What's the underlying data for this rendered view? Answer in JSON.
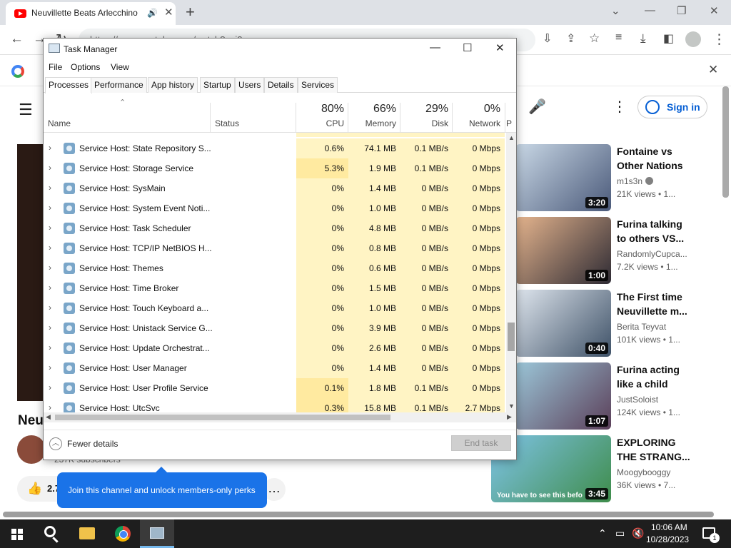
{
  "browser": {
    "tab_title": "Neuvillette Beats Arlecchino",
    "tab_icon": "youtube-icon",
    "tab_audio_icon": "speaker-icon",
    "url_partial": "https://www.youtube.com/watch?v=j2...",
    "bookmark_icon": "google-icon"
  },
  "youtube": {
    "signin_label": "Sign in",
    "video_title_partial": "Neu",
    "subscriber_text_partial": "237K subscribers",
    "like_count_partial": "2.7",
    "tooltip_text": "Join this channel and unlock members-only perks",
    "recommendations": [
      {
        "title": "Fontaine vs Other Nations",
        "channel": "m1s3n",
        "verified": true,
        "views": "21K views • 1...",
        "duration": "3:20",
        "color_a": "#c9d8e6",
        "color_b": "#4b5a7a"
      },
      {
        "title": "Furina talking to others VS...",
        "channel": "RandomlyCupca...",
        "verified": false,
        "views": "7.2K views • 1...",
        "duration": "1:00",
        "color_a": "#e6b58e",
        "color_b": "#2d2a33"
      },
      {
        "title": "The First time Neuvillette m...",
        "channel": "Berita Teyvat",
        "verified": false,
        "views": "101K views • 1...",
        "duration": "0:40",
        "color_a": "#dfe6ee",
        "color_b": "#3e5167"
      },
      {
        "title": "Furina acting like a child",
        "channel": "JustSoloist",
        "verified": false,
        "views": "124K views • 1...",
        "duration": "1:07",
        "color_a": "#9cc7d9",
        "color_b": "#5b3f59"
      },
      {
        "title": "EXPLORING THE STRANG...",
        "channel": "Moogybooggy",
        "verified": false,
        "views": "36K views • 7...",
        "duration": "3:45",
        "caption": "You have to see this befo",
        "color_a": "#7fc4e8",
        "color_b": "#3e8c4a"
      }
    ]
  },
  "task_manager": {
    "title": "Task Manager",
    "menu": [
      "File",
      "Options",
      "View"
    ],
    "tabs": [
      "Processes",
      "Performance",
      "App history",
      "Startup",
      "Users",
      "Details",
      "Services"
    ],
    "active_tab": "Processes",
    "columns": {
      "name": "Name",
      "status": "Status",
      "cpu": {
        "pct": "80%",
        "label": "CPU"
      },
      "memory": {
        "pct": "66%",
        "label": "Memory"
      },
      "disk": {
        "pct": "29%",
        "label": "Disk"
      },
      "network": {
        "pct": "0%",
        "label": "Network"
      },
      "power_partial": "P"
    },
    "rows": [
      {
        "name": "Service Host: State Repository S...",
        "cpu": "0.6%",
        "memory": "74.1 MB",
        "disk": "0.1 MB/s",
        "network": "0 Mbps"
      },
      {
        "name": "Service Host: Storage Service",
        "cpu": "5.3%",
        "memory": "1.9 MB",
        "disk": "0.1 MB/s",
        "network": "0 Mbps"
      },
      {
        "name": "Service Host: SysMain",
        "cpu": "0%",
        "memory": "1.4 MB",
        "disk": "0 MB/s",
        "network": "0 Mbps"
      },
      {
        "name": "Service Host: System Event Noti...",
        "cpu": "0%",
        "memory": "1.0 MB",
        "disk": "0 MB/s",
        "network": "0 Mbps"
      },
      {
        "name": "Service Host: Task Scheduler",
        "cpu": "0%",
        "memory": "4.8 MB",
        "disk": "0 MB/s",
        "network": "0 Mbps"
      },
      {
        "name": "Service Host: TCP/IP NetBIOS H...",
        "cpu": "0%",
        "memory": "0.8 MB",
        "disk": "0 MB/s",
        "network": "0 Mbps"
      },
      {
        "name": "Service Host: Themes",
        "cpu": "0%",
        "memory": "0.6 MB",
        "disk": "0 MB/s",
        "network": "0 Mbps"
      },
      {
        "name": "Service Host: Time Broker",
        "cpu": "0%",
        "memory": "1.5 MB",
        "disk": "0 MB/s",
        "network": "0 Mbps"
      },
      {
        "name": "Service Host: Touch Keyboard a...",
        "cpu": "0%",
        "memory": "1.0 MB",
        "disk": "0 MB/s",
        "network": "0 Mbps"
      },
      {
        "name": "Service Host: Unistack Service G...",
        "cpu": "0%",
        "memory": "3.9 MB",
        "disk": "0 MB/s",
        "network": "0 Mbps"
      },
      {
        "name": "Service Host: Update Orchestrat...",
        "cpu": "0%",
        "memory": "2.6 MB",
        "disk": "0 MB/s",
        "network": "0 Mbps"
      },
      {
        "name": "Service Host: User Manager",
        "cpu": "0%",
        "memory": "1.4 MB",
        "disk": "0 MB/s",
        "network": "0 Mbps"
      },
      {
        "name": "Service Host: User Profile Service",
        "cpu": "0.1%",
        "memory": "1.8 MB",
        "disk": "0.1 MB/s",
        "network": "0 Mbps"
      },
      {
        "name": "Service Host: UtcSvc",
        "cpu": "0.3%",
        "memory": "15.8 MB",
        "disk": "0.1 MB/s",
        "network": "2.7 Mbps"
      }
    ],
    "fewer_details_label": "Fewer details",
    "end_task_label": "End task"
  },
  "taskbar": {
    "time": "10:06 AM",
    "date": "10/28/2023",
    "notification_count": "1",
    "pinned": [
      "start-icon",
      "search-icon",
      "file-explorer-icon",
      "chrome-icon",
      "task-manager-icon"
    ]
  },
  "colors": {
    "tm_cell_bg": "#fff4c4",
    "tm_cell_hot": "#ffeaa0",
    "yt_blue": "#065fd4",
    "tooltip_blue": "#1a73e8",
    "taskbar_bg": "#1e1e1e"
  }
}
